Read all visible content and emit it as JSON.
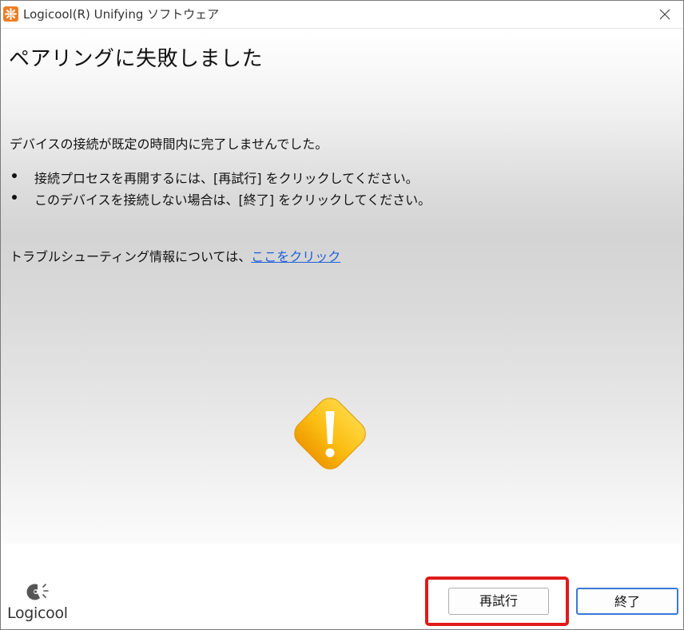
{
  "window": {
    "title": "Logicool(R) Unifying ソフトウェア",
    "app_icon": "logicool-unifying-icon",
    "close_icon": "close-icon"
  },
  "main": {
    "heading": "ペアリングに失敗しました",
    "message": "デバイスの接続が既定の時間内に完了しませんでした。",
    "bullets": [
      "接続プロセスを再開するには、[再試行] をクリックしてください。",
      "このデバイスを接続しない場合は、[終了] をクリックしてください。"
    ],
    "troubleshoot_text": "トラブルシューティング情報については、",
    "troubleshoot_link": "ここをクリック",
    "warning_icon": "warning-icon"
  },
  "footer": {
    "logo_text": "Logicool",
    "retry_label": "再試行",
    "quit_label": "終了"
  },
  "colors": {
    "accent": "#ee7d23",
    "link": "#1f5fd6",
    "highlight": "#e01a1a",
    "warning": "#f7b500"
  }
}
